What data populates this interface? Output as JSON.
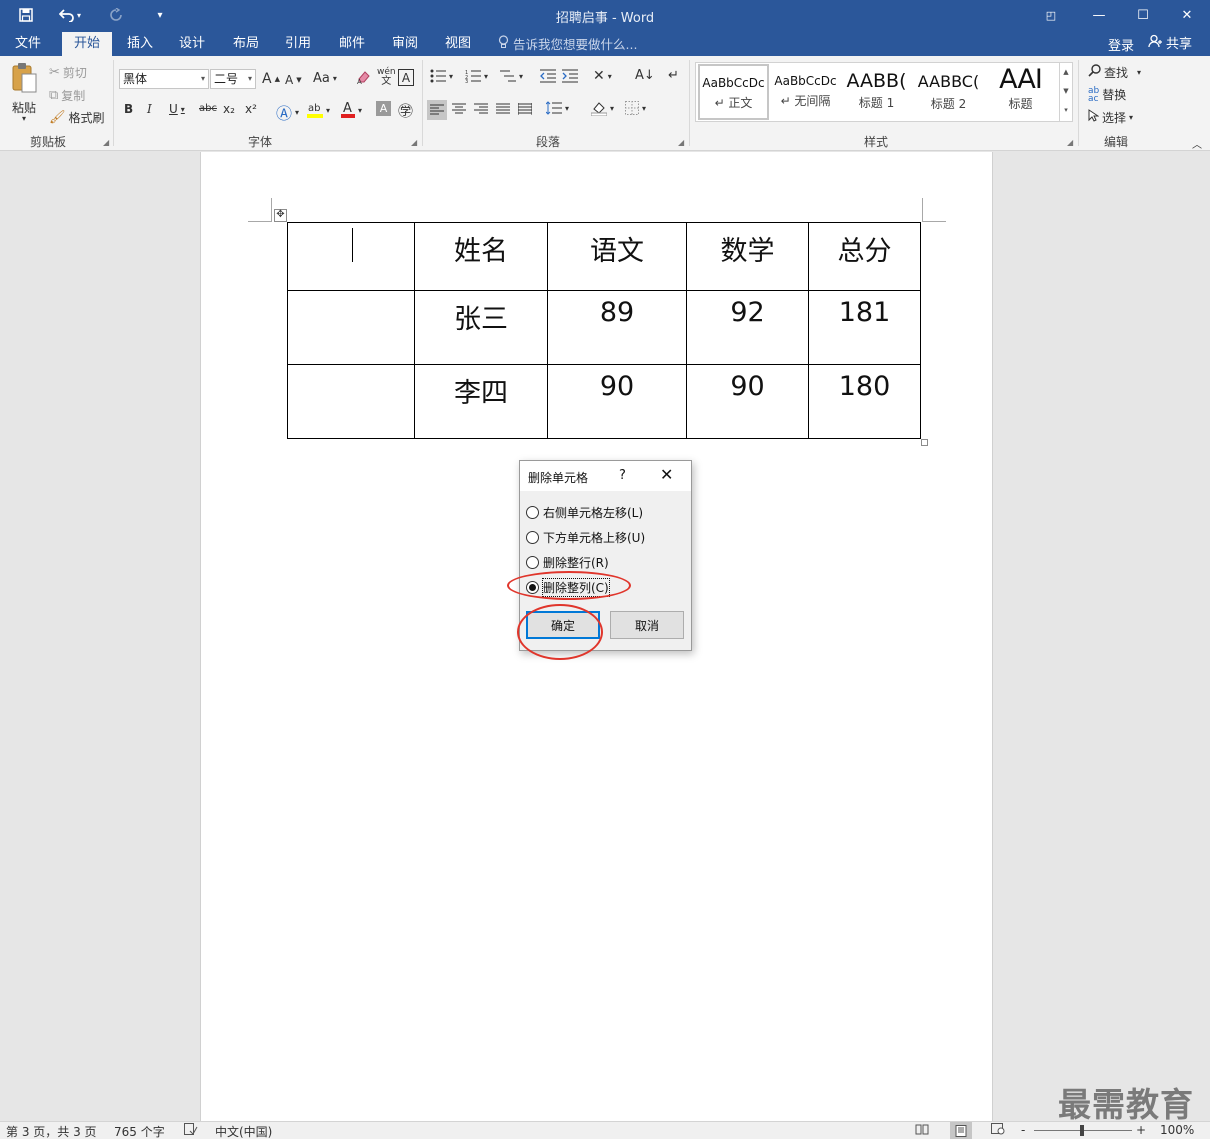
{
  "window": {
    "title": "招聘启事 - Word",
    "quick_access": {
      "save_icon": "save-icon",
      "undo_icon": "undo-icon",
      "redo_icon": "redo-icon",
      "customize_icon": "customize-icon"
    },
    "controls": {
      "restore_ribbon": "◰",
      "minimize": "—",
      "maximize": "☐",
      "close": "✕"
    }
  },
  "tabs": [
    {
      "label": "文件"
    },
    {
      "label": "开始"
    },
    {
      "label": "插入"
    },
    {
      "label": "设计"
    },
    {
      "label": "布局"
    },
    {
      "label": "引用"
    },
    {
      "label": "邮件"
    },
    {
      "label": "审阅"
    },
    {
      "label": "视图"
    }
  ],
  "active_tab": "开始",
  "tell_me": "告诉我您想要做什么...",
  "account": {
    "signin": "登录",
    "share": "共享"
  },
  "ribbon": {
    "clipboard": {
      "paste": "粘贴",
      "cut": "剪切",
      "copy": "复制",
      "format_painter": "格式刷",
      "label": "剪贴板"
    },
    "font": {
      "name": "黑体",
      "size": "二号",
      "label": "字体",
      "grow": "A",
      "shrink": "A",
      "case": "Aa",
      "bold": "B",
      "italic": "I",
      "underline": "U",
      "strike": "abc",
      "sub": "x₂",
      "sup": "x²",
      "phonetic": "wén",
      "border_char": "A"
    },
    "paragraph": {
      "label": "段落"
    },
    "styles": {
      "label": "样式",
      "items": [
        {
          "sample": "AaBbCcDc",
          "name": "↵ 正文"
        },
        {
          "sample": "AaBbCcDc",
          "name": "↵ 无间隔"
        },
        {
          "sample": "AABB(",
          "name": "标题 1"
        },
        {
          "sample": "AABBC(",
          "name": "标题 2"
        },
        {
          "sample": "AAI",
          "name": "标题"
        }
      ]
    },
    "editing": {
      "find": "查找",
      "replace": "替换",
      "select": "选择",
      "label": "编辑"
    }
  },
  "document": {
    "table": {
      "rows": [
        [
          "",
          "姓名",
          "语文",
          "数学",
          "总分"
        ],
        [
          "",
          "张三",
          "89",
          "92",
          "181"
        ],
        [
          "",
          "李四",
          "90",
          "90",
          "180"
        ]
      ]
    }
  },
  "dialog": {
    "title": "删除单元格",
    "help": "?",
    "close": "✕",
    "options": [
      {
        "label": "右侧单元格左移(L)",
        "selected": false
      },
      {
        "label": "下方单元格上移(U)",
        "selected": false
      },
      {
        "label": "删除整行(R)",
        "selected": false
      },
      {
        "label": "删除整列(C)",
        "selected": true
      }
    ],
    "ok": "确定",
    "cancel": "取消",
    "annotation_color": "#e0352b"
  },
  "statusbar": {
    "page": "第 3 页，共 3 页",
    "words": "765 个字",
    "language": "中文(中国)",
    "zoom": "100%",
    "zoom_minus": "-",
    "zoom_plus": "+"
  },
  "watermark": "最需教育",
  "colors": {
    "brand": "#2b579a",
    "dialog_default_border": "#0078d7"
  }
}
